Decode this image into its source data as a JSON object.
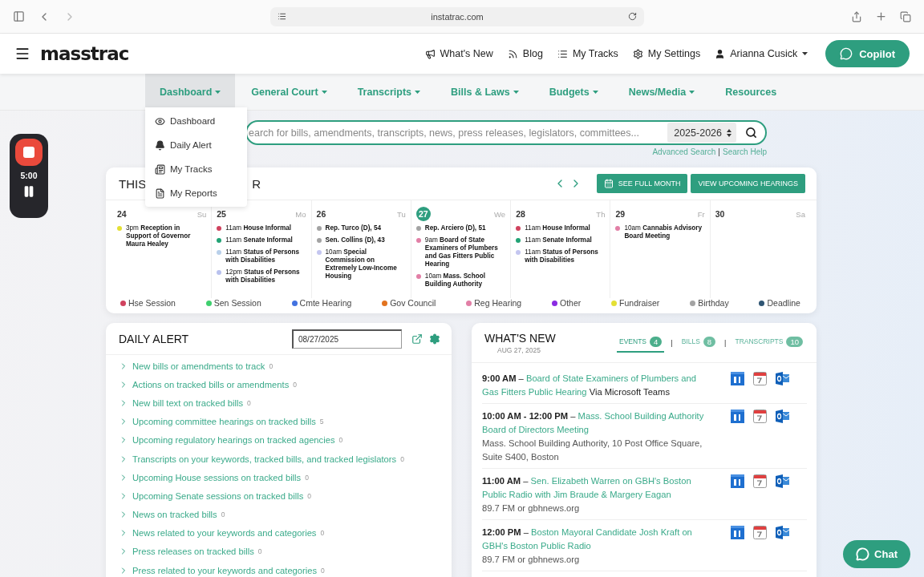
{
  "browser": {
    "url": "instatrac.com"
  },
  "header": {
    "logo": "masstrac",
    "links": [
      {
        "label": "What's New",
        "kind": "megaphone"
      },
      {
        "label": "Blog",
        "kind": "rss"
      },
      {
        "label": "My Tracks",
        "kind": "list"
      },
      {
        "label": "My Settings",
        "kind": "gear"
      },
      {
        "label": "Arianna Cusick",
        "kind": "user"
      }
    ],
    "copilot": "Copilot"
  },
  "nav": [
    {
      "label": "Dashboard",
      "selected": true,
      "has_menu": true
    },
    {
      "label": "General Court",
      "selected": false,
      "has_menu": true
    },
    {
      "label": "Transcripts",
      "selected": false,
      "has_menu": true
    },
    {
      "label": "Bills & Laws",
      "selected": false,
      "has_menu": true
    },
    {
      "label": "Budgets",
      "selected": false,
      "has_menu": true
    },
    {
      "label": "News/Media",
      "selected": false,
      "has_menu": true
    },
    {
      "label": "Resources",
      "selected": false,
      "has_menu": false
    }
  ],
  "dashboard_menu": [
    {
      "label": "Dashboard",
      "kind": "eye"
    },
    {
      "label": "Daily Alert",
      "kind": "bell"
    },
    {
      "label": "My Tracks",
      "kind": "tracks"
    },
    {
      "label": "My Reports",
      "kind": "report"
    }
  ],
  "search": {
    "placeholder": "earch for bills, amendments, transcripts, news, press releases, legislators, committees...",
    "session": "2025-2026",
    "links": [
      "Advanced Search",
      "Search Help"
    ],
    "separator": "|"
  },
  "recorder": {
    "time": "5:00"
  },
  "calendar": {
    "title_start": "THIS",
    "title_end": "R",
    "buttons": [
      "SEE FULL MONTH",
      "VIEW UPCOMING HEARINGS"
    ],
    "days": [
      {
        "date": "24",
        "weekday": "Su",
        "selected": false,
        "events": [
          {
            "time": "3pm",
            "title": "Reception in Support of Governor Maura Healey",
            "color": "#e4e034"
          }
        ]
      },
      {
        "date": "25",
        "weekday": "Mo",
        "selected": false,
        "events": [
          {
            "time": "11am",
            "title": "House Informal",
            "color": "#d0425e"
          },
          {
            "time": "11am",
            "title": "Senate Informal",
            "color": "#22a375"
          },
          {
            "time": "11am",
            "title": "Status of Persons with Disabilities",
            "color": "#b9d0ea"
          },
          {
            "time": "12pm",
            "title": "Status of Persons with Disabilities",
            "color": "#b9c2ee"
          }
        ]
      },
      {
        "date": "26",
        "weekday": "Tu",
        "selected": false,
        "events": [
          {
            "title": "Rep. Turco (D), 54",
            "color": "#a3a3a3"
          },
          {
            "title": "Sen. Collins (D), 43",
            "color": "#a3a3a3"
          },
          {
            "time": "10am",
            "title": "Special Commission on Extremely Low-Income Housing",
            "color": "#c4c6f0"
          }
        ]
      },
      {
        "date": "27",
        "weekday": "We",
        "selected": true,
        "events": [
          {
            "title": "Rep. Arciero (D), 51",
            "color": "#a3a3a3"
          },
          {
            "time": "9am",
            "title": "Board of State Examiners of Plumbers and Gas Fitters Public Hearing",
            "color": "#e27fa6"
          },
          {
            "time": "10am",
            "title": "Mass. School Building Authority",
            "color": "#e27fa6"
          }
        ]
      },
      {
        "date": "28",
        "weekday": "Th",
        "selected": false,
        "events": [
          {
            "time": "11am",
            "title": "House Informal",
            "color": "#d0425e"
          },
          {
            "time": "11am",
            "title": "Senate Informal",
            "color": "#22a375"
          },
          {
            "time": "11am",
            "title": "Status of Persons with Disabilities",
            "color": "#c4c6f0"
          }
        ]
      },
      {
        "date": "29",
        "weekday": "Fr",
        "selected": false,
        "events": [
          {
            "time": "10am",
            "title": "Cannabis Advisory Board Meeting",
            "color": "#e27fa6"
          }
        ]
      },
      {
        "date": "30",
        "weekday": "Sa",
        "selected": false
      }
    ],
    "legend": [
      {
        "label": "Hse Session",
        "color": "#d0425e"
      },
      {
        "label": "Sen Session",
        "color": "#3fcf6e"
      },
      {
        "label": "Cmte Hearing",
        "color": "#4272e0"
      },
      {
        "label": "Gov Council",
        "color": "#e2731f"
      },
      {
        "label": "Reg Hearing",
        "color": "#e27fa6"
      },
      {
        "label": "Other",
        "color": "#8a2be2"
      },
      {
        "label": "Fundraiser",
        "color": "#e4e034"
      },
      {
        "label": "Birthday",
        "color": "#a3a3a3"
      },
      {
        "label": "Deadline",
        "color": "#2f5573"
      }
    ]
  },
  "daily_alert": {
    "title": "DAILY ALERT",
    "date": "08/27/2025",
    "items": [
      {
        "label": "New bills or amendments to track",
        "count": "0"
      },
      {
        "label": "Actions on tracked bills or amendments",
        "count": "0"
      },
      {
        "label": "New bill text on tracked bills",
        "count": "0"
      },
      {
        "label": "Upcoming committee hearings on tracked bills",
        "count": "5"
      },
      {
        "label": "Upcoming regulatory hearings on tracked agencies",
        "count": "0"
      },
      {
        "label": "Transcripts on your keywords, tracked bills, and tracked legislators",
        "count": "0"
      },
      {
        "label": "Upcoming House sessions on tracked bills",
        "count": "0"
      },
      {
        "label": "Upcoming Senate sessions on tracked bills",
        "count": "0"
      },
      {
        "label": "News on tracked bills",
        "count": "0"
      },
      {
        "label": "News related to your keywords and categories",
        "count": "0"
      },
      {
        "label": "Press releases on tracked bills",
        "count": "0"
      },
      {
        "label": "Press related to your keywords and categories",
        "count": "0"
      }
    ]
  },
  "whats_new": {
    "title": "WHAT'S NEW",
    "date": "AUG 27, 2025",
    "separator": "|",
    "time_separator": "–",
    "tabs": [
      {
        "label": "EVENTS",
        "count": "4",
        "selected": true
      },
      {
        "label": "BILLS",
        "count": "8",
        "selected": false
      },
      {
        "label": "TRANSCRIPTS",
        "count": "10",
        "selected": false
      }
    ],
    "events": [
      {
        "time": "9:00 AM",
        "title": "Board of State Examiners of Plumbers and Gas Fitters Public Hearing",
        "via": "Via Microsoft Teams"
      },
      {
        "time": "10:00 AM - 12:00 PM",
        "title": "Mass. School Building Authority Board of Directors Meeting",
        "location": "Mass. School Building Authority, 10 Post Office Square, Suite S400, Boston"
      },
      {
        "time": "11:00 AM",
        "title": "Sen. Elizabeth Warren on GBH's Boston Public Radio with Jim Braude & Margery Eagan",
        "location": "89.7 FM or gbhnews.org"
      },
      {
        "time": "12:00 PM",
        "title": "Boston Mayoral Candidate Josh Kraft on GBH's Boston Public Radio",
        "location": "89.7 FM or gbhnews.org"
      }
    ]
  },
  "chat": "Chat"
}
